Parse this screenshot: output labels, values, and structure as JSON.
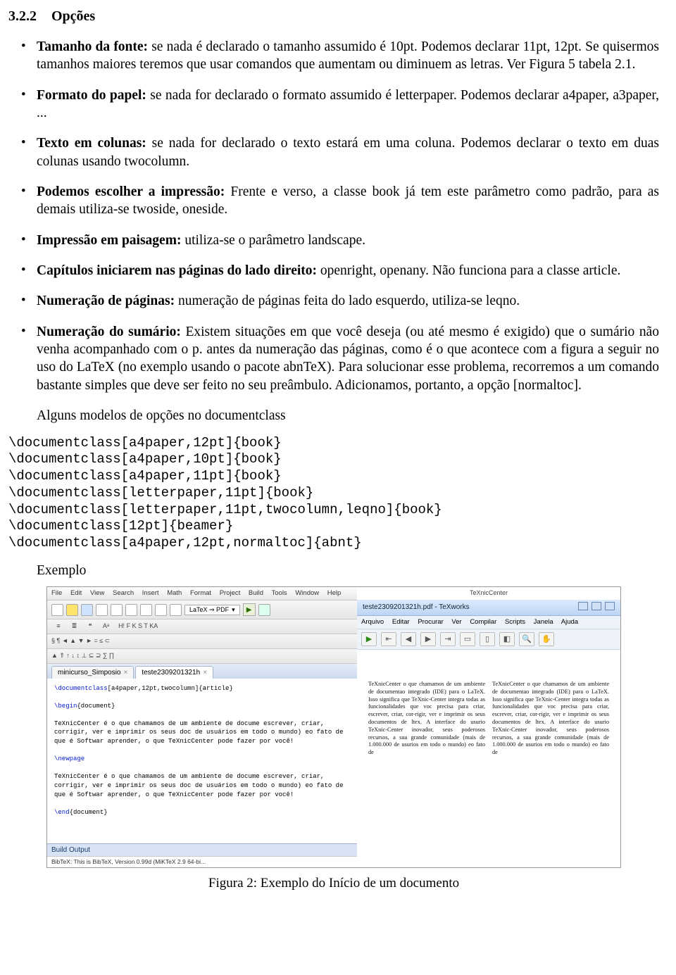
{
  "section": {
    "number": "3.2.2",
    "title": "Opções"
  },
  "items": [
    {
      "label": "Tamanho da fonte:",
      "text": "se nada é declarado o tamanho assumido é 10pt. Podemos declarar 11pt, 12pt. Se quisermos tamanhos maiores teremos que usar comandos que aumentam ou diminuem as letras. Ver Figura 5 tabela 2.1."
    },
    {
      "label": "Formato do papel:",
      "text": "se nada for declarado o formato assumido é letterpaper. Podemos declarar a4paper, a3paper, ..."
    },
    {
      "label": "Texto em colunas:",
      "text": "se nada for declarado o texto estará em uma coluna. Podemos declarar o texto em duas colunas usando twocolumn."
    },
    {
      "label": "Podemos escolher a impressão:",
      "text": "Frente e verso, a classe book já tem este parâmetro como padrão, para as demais utiliza-se twoside, oneside."
    },
    {
      "label": "Impressão em paisagem:",
      "text": "utiliza-se o parâmetro landscape."
    },
    {
      "label": "Capítulos iniciarem nas páginas do lado direito:",
      "text": "openright, openany. Não funciona para a classe article."
    },
    {
      "label": "Numeração de páginas:",
      "text": "numeração de páginas feita do lado esquerdo, utiliza-se leqno."
    },
    {
      "label": "Numeração do sumário:",
      "text": "Existem situações em que você deseja (ou até mesmo é exigido) que o sumário não venha acompanhado com o p. antes da numeração das páginas, como é o que acontece com a figura a seguir no uso do LaTeX (no exemplo usando o pacote abnTeX). Para solucionar esse problema, recorremos a um comando bastante simples que deve ser feito no seu preâmbulo. Adicionamos, portanto, a opção [normaltoc]."
    }
  ],
  "after_list": "Alguns modelos de opções no documentclass",
  "code": "\\documentclass[a4paper,12pt]{book}\n\\documentclass[a4paper,10pt]{book}\n\\documentclass[a4paper,11pt]{book}\n\\documentclass[letterpaper,11pt]{book}\n\\documentclass[letterpaper,11pt,twocolumn,leqno]{book}\n\\documentclass[12pt]{beamer}\n\\documentclass[a4paper,12pt,normaltoc]{abnt}",
  "exemplo": "Exemplo",
  "caption": "Figura 2: Exemplo do Início de um documento",
  "mock": {
    "menuL": [
      "File",
      "Edit",
      "View",
      "Search",
      "Insert",
      "Math",
      "Format",
      "Project",
      "Build",
      "Tools",
      "Window",
      "Help"
    ],
    "profile": "LaTeX ⇒ PDF",
    "sym_row1": "H!  F  K  S  T  KA",
    "sym_row2_left": "§   ¶   ◄   ▲   ▼   ►    =    ≤    ⊂",
    "sym_row2_right": "▲   ⇑   ↑   ↓   ↕   ⊥   ⊆   ⊇   ∑   ∏",
    "tabs": [
      {
        "name": "minicurso_Simposio",
        "active": false
      },
      {
        "name": "teste2309201321h",
        "active": true
      }
    ],
    "editor": {
      "l1a": "\\documentclass",
      "l1b": "[a4paper,12pt,twocolumn]{article}",
      "l2a": "\\begin",
      "l2b": "{document}",
      "para1": "TeXnicCenter é o que chamamos de um ambiente de docume escrever, criar, corrigir, ver e imprimir os seus doc de usuários em todo o mundo) eo fato de que é Softwar aprender, o que TeXnicCenter pode fazer por você!",
      "np": "\\newpage",
      "para2": "TeXnicCenter é o que chamamos de um ambiente de docume escrever, criar, corrigir, ver e imprimir os seus doc de usuários em todo o mundo) eo fato de que é Softwar aprender, o que TeXnicCenter pode fazer por você!",
      "l3a": "\\end",
      "l3b": "{document}"
    },
    "build_label": "Build Output",
    "build_line": "BibTeX: This is BibTeX, Version 0.99d (MiKTeX 2.9 64-bi...",
    "rightHeader": "TeXnicCenter",
    "rightTitle": "teste2309201321h.pdf - TeXworks",
    "menuR": [
      "Arquivo",
      "Editar",
      "Procurar",
      "Ver",
      "Compilar",
      "Scripts",
      "Janela",
      "Ajuda"
    ],
    "col": "TeXnicCenter   o que chamamos de um ambiente de documentao integrado (IDE) para o LaTeX. Isso significa que TeXnic-Center integra todas as funcionalidades que voc precisa para criar, escrever, criar, cor-rigir, ver e imprimir os seus documentos de ltex.  A interface do usurio TeXnic-Center inovador, seus poderosos recursos, a sua grande comunidade (mais de 1.000.000 de usurios em todo o mundo) eo fato de"
  }
}
